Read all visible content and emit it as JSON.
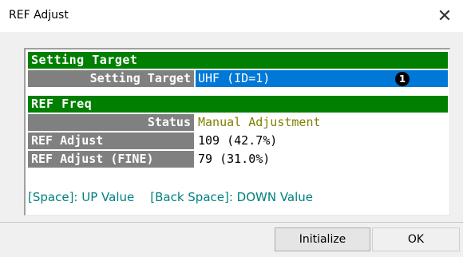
{
  "window": {
    "title": "REF Adjust",
    "close_glyph": "✕"
  },
  "setting_target_section": {
    "header": "Setting Target",
    "row": {
      "label": "Setting Target",
      "value": "UHF (ID=1)",
      "badge": "1"
    }
  },
  "ref_freq_section": {
    "header": "REF Freq",
    "rows": [
      {
        "label": "Status",
        "value": "Manual Adjustment"
      },
      {
        "label": "REF Adjust",
        "value": "109 (42.7%)"
      },
      {
        "label": "REF Adjust (FINE)",
        "value": "79 (31.0%)"
      }
    ]
  },
  "hint": {
    "up": "[Space]: UP Value",
    "down": "[Back Space]: DOWN Value"
  },
  "buttons": {
    "initialize": "Initialize",
    "ok": "OK"
  },
  "colors": {
    "section": "#007f00",
    "label_bg": "#808080",
    "selection": "#0078d7",
    "status_value": "#7f7f00",
    "hint": "#008080"
  }
}
